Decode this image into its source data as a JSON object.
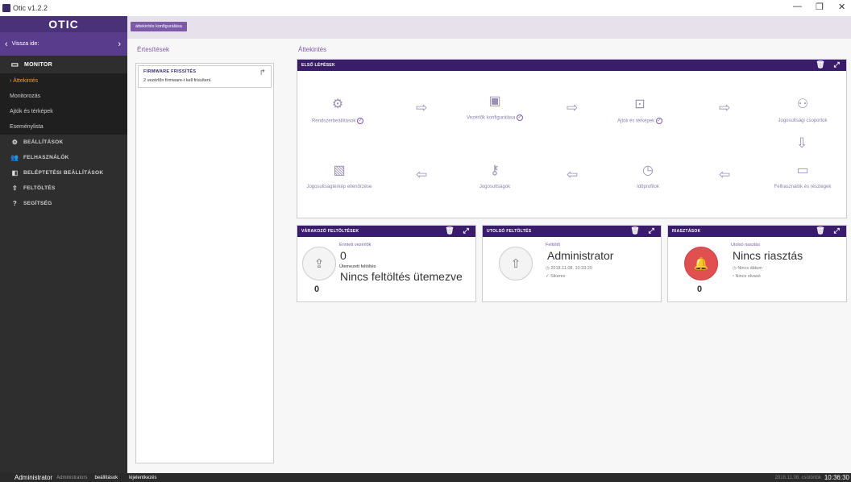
{
  "window": {
    "title": "Otic v1.2.2"
  },
  "sidebar": {
    "logo": "OTIC",
    "back_label": "Vissza ide:",
    "monitor_header": "MONITOR",
    "monitor_items": [
      {
        "label": "Áttekintés",
        "active": true
      },
      {
        "label": "Monitorozás"
      },
      {
        "label": "Ajtók és térképek"
      },
      {
        "label": "Eseménylista"
      }
    ],
    "sections": [
      {
        "label": "BEÁLLÍTÁSOK",
        "icon": "gear-icon"
      },
      {
        "label": "FELHASZNÁLÓK",
        "icon": "users-icon"
      },
      {
        "label": "BELÉPTETÉSI BEÁLLÍTÁSOK",
        "icon": "door-icon"
      },
      {
        "label": "FELTÖLTÉS",
        "icon": "upload-icon"
      },
      {
        "label": "SEGÍTSÉG",
        "icon": "help-icon"
      }
    ]
  },
  "toolbar": {
    "config_button": "áttekintés konfigurálása"
  },
  "notifications": {
    "title": "Értesítések",
    "cards": [
      {
        "title": "FIRMWARE FRISSÍTÉS",
        "text": "2 vezérlőn firmware-t kell frissíteni."
      }
    ]
  },
  "overview": {
    "title": "Áttekintés",
    "first_steps": {
      "header": "ELSŐ LÉPÉSEK",
      "steps": [
        {
          "label": "Rendszerbeállítások",
          "icon": "gear-icon"
        },
        {
          "label": "Vezérlők konfigurálása",
          "icon": "chip-icon"
        },
        {
          "label": "Ajtók és térképek",
          "icon": "door-icon"
        },
        {
          "label": "Jogosultsági csoportok",
          "icon": "group-icon"
        },
        {
          "label": "Felhasználók és részlegek",
          "icon": "folder-icon"
        },
        {
          "label": "Időprofilok",
          "icon": "clock-icon"
        },
        {
          "label": "Jogosultságok",
          "icon": "key-icon"
        },
        {
          "label": "Jogosultságtérkép ellenőrzése",
          "icon": "map-icon"
        }
      ]
    },
    "pending": {
      "header": "VÁRAKOZÓ FELTÖLTÉSEK",
      "affected_label": "Érintett vezérlők",
      "affected_value": "0",
      "scheduled_label": "Ütemezett feltöltés",
      "scheduled_value": "Nincs feltöltés ütemezve",
      "count": "0"
    },
    "last_upload": {
      "header": "UTOLSÓ FELTÖLTÉS",
      "uploader_label": "Feltöltő",
      "uploader_value": "Administrator",
      "datetime": "2018.11.08. 10:33:20",
      "status": "Sikeres"
    },
    "alarms": {
      "header": "RIASZTÁSOK",
      "last_label": "Utolsó riasztás",
      "last_value": "Nincs riasztás",
      "no_date": "Nincs dátum",
      "no_reader": "Nincs olvasó",
      "count": "0"
    }
  },
  "statusbar": {
    "user": "Administrator",
    "role": "Administrators",
    "settings": "beállítások",
    "logout": "kijelentkezés",
    "date": "2018.11.08. csütörtök",
    "time": "10:36:30"
  }
}
